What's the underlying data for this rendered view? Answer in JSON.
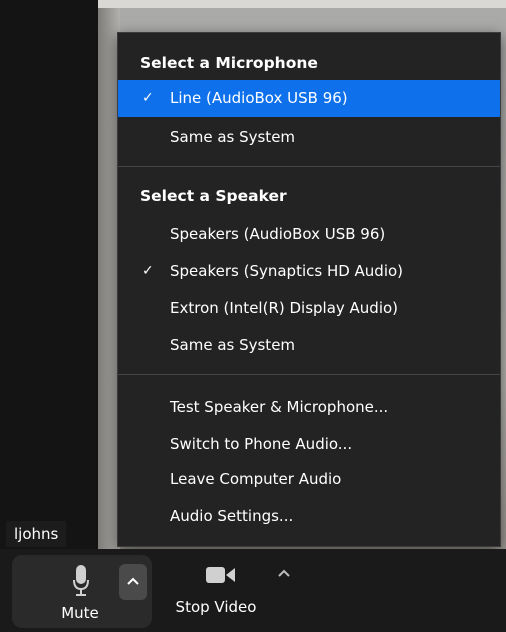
{
  "participant": {
    "name": "ljohns"
  },
  "menu": {
    "microphone_title": "Select a Microphone",
    "microphones": [
      {
        "label": "Line (AudioBox USB 96)",
        "selected": true
      },
      {
        "label": "Same as System",
        "selected": false
      }
    ],
    "speaker_title": "Select a Speaker",
    "speakers": [
      {
        "label": "Speakers (AudioBox USB 96)",
        "selected": false
      },
      {
        "label": "Speakers (Synaptics HD Audio)",
        "selected": true
      },
      {
        "label": "Extron (Intel(R) Display Audio)",
        "selected": false
      },
      {
        "label": "Same as System",
        "selected": false
      }
    ],
    "actions": [
      {
        "label": "Test Speaker & Microphone..."
      },
      {
        "label": "Switch to Phone Audio..."
      },
      {
        "label": "Leave Computer Audio"
      },
      {
        "label": "Audio Settings..."
      }
    ],
    "check_glyph": "✓"
  },
  "toolbar": {
    "mute_label": "Mute",
    "stop_video_label": "Stop Video"
  },
  "icons": {
    "microphone": "microphone-icon",
    "camera": "video-camera-icon",
    "chevron": "chevron-up-icon",
    "check": "checkmark-icon"
  },
  "colors": {
    "menu_bg": "#232323",
    "highlight": "#0e71eb",
    "toolbar_bg": "#1a1a1a"
  }
}
